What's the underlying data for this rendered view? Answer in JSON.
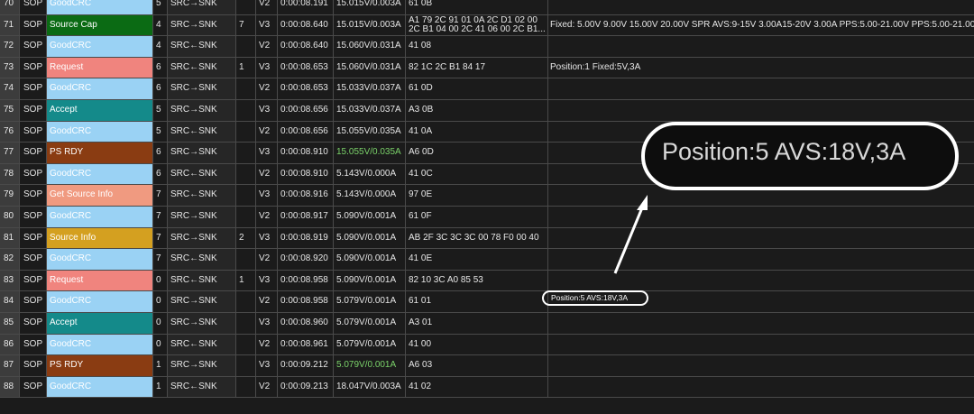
{
  "rows": [
    {
      "idx": "70",
      "sop": "SOP",
      "msg": "GoodCRC",
      "color": "#9ad2f4",
      "text": "#ffffff",
      "cnt": "5",
      "dir": "SRC→SNK",
      "obj": "",
      "ver": "V2",
      "time": "0:00:08.191",
      "vi": "15.015V/0.003A",
      "vi_green": false,
      "raw": "61 0B",
      "dec": ""
    },
    {
      "idx": "71",
      "sop": "SOP",
      "msg": "Source Cap",
      "color": "#0b6b14",
      "text": "#ffffff",
      "cnt": "4",
      "dir": "SRC→SNK",
      "obj": "7",
      "ver": "V3",
      "time": "0:00:08.640",
      "vi": "15.015V/0.003A",
      "vi_green": false,
      "raw": "A1 79 2C 91 01 0A 2C D1 02 00 2C B1 04 00 2C 41 06 00 2C B1...",
      "dec": "Fixed: 5.00V  9.00V  15.00V  20.00V  SPR AVS:9-15V 3.00A15-20V 3.00A  PPS:5.00-21.00V  PPS:5.00-21.00V"
    },
    {
      "idx": "72",
      "sop": "SOP",
      "msg": "GoodCRC",
      "color": "#9ad2f4",
      "text": "#ffffff",
      "cnt": "4",
      "dir": "SRC←SNK",
      "obj": "",
      "ver": "V2",
      "time": "0:00:08.640",
      "vi": "15.060V/0.031A",
      "vi_green": false,
      "raw": "41 08",
      "dec": ""
    },
    {
      "idx": "73",
      "sop": "SOP",
      "msg": "Request",
      "color": "#f0847e",
      "text": "#ffffff",
      "cnt": "6",
      "dir": "SRC←SNK",
      "obj": "1",
      "ver": "V3",
      "time": "0:00:08.653",
      "vi": "15.060V/0.031A",
      "vi_green": false,
      "raw": "82 1C 2C B1 84 17",
      "dec": "Position:1  Fixed:5V,3A"
    },
    {
      "idx": "74",
      "sop": "SOP",
      "msg": "GoodCRC",
      "color": "#9ad2f4",
      "text": "#ffffff",
      "cnt": "6",
      "dir": "SRC→SNK",
      "obj": "",
      "ver": "V2",
      "time": "0:00:08.653",
      "vi": "15.033V/0.037A",
      "vi_green": false,
      "raw": "61 0D",
      "dec": ""
    },
    {
      "idx": "75",
      "sop": "SOP",
      "msg": "Accept",
      "color": "#148a8a",
      "text": "#ffffff",
      "cnt": "5",
      "dir": "SRC→SNK",
      "obj": "",
      "ver": "V3",
      "time": "0:00:08.656",
      "vi": "15.033V/0.037A",
      "vi_green": false,
      "raw": "A3 0B",
      "dec": ""
    },
    {
      "idx": "76",
      "sop": "SOP",
      "msg": "GoodCRC",
      "color": "#9ad2f4",
      "text": "#ffffff",
      "cnt": "5",
      "dir": "SRC←SNK",
      "obj": "",
      "ver": "V2",
      "time": "0:00:08.656",
      "vi": "15.055V/0.035A",
      "vi_green": false,
      "raw": "41 0A",
      "dec": ""
    },
    {
      "idx": "77",
      "sop": "SOP",
      "msg": "PS RDY",
      "color": "#8a3c12",
      "text": "#ffffff",
      "cnt": "6",
      "dir": "SRC→SNK",
      "obj": "",
      "ver": "V3",
      "time": "0:00:08.910",
      "vi": "15.055V/0.035A",
      "vi_green": true,
      "raw": "A6 0D",
      "dec": ""
    },
    {
      "idx": "78",
      "sop": "SOP",
      "msg": "GoodCRC",
      "color": "#9ad2f4",
      "text": "#ffffff",
      "cnt": "6",
      "dir": "SRC←SNK",
      "obj": "",
      "ver": "V2",
      "time": "0:00:08.910",
      "vi": "5.143V/0.000A",
      "vi_green": false,
      "raw": "41 0C",
      "dec": ""
    },
    {
      "idx": "79",
      "sop": "SOP",
      "msg": "Get Source Info",
      "color": "#f09a80",
      "text": "#ffffff",
      "cnt": "7",
      "dir": "SRC←SNK",
      "obj": "",
      "ver": "V3",
      "time": "0:00:08.916",
      "vi": "5.143V/0.000A",
      "vi_green": false,
      "raw": "97 0E",
      "dec": ""
    },
    {
      "idx": "80",
      "sop": "SOP",
      "msg": "GoodCRC",
      "color": "#9ad2f4",
      "text": "#ffffff",
      "cnt": "7",
      "dir": "SRC→SNK",
      "obj": "",
      "ver": "V2",
      "time": "0:00:08.917",
      "vi": "5.090V/0.001A",
      "vi_green": false,
      "raw": "61 0F",
      "dec": ""
    },
    {
      "idx": "81",
      "sop": "SOP",
      "msg": "Source Info",
      "color": "#d4a020",
      "text": "#ffffff",
      "cnt": "7",
      "dir": "SRC→SNK",
      "obj": "2",
      "ver": "V3",
      "time": "0:00:08.919",
      "vi": "5.090V/0.001A",
      "vi_green": false,
      "raw": "AB 2F 3C 3C 3C 00 78 F0 00 40",
      "dec": ""
    },
    {
      "idx": "82",
      "sop": "SOP",
      "msg": "GoodCRC",
      "color": "#9ad2f4",
      "text": "#ffffff",
      "cnt": "7",
      "dir": "SRC←SNK",
      "obj": "",
      "ver": "V2",
      "time": "0:00:08.920",
      "vi": "5.090V/0.001A",
      "vi_green": false,
      "raw": "41 0E",
      "dec": ""
    },
    {
      "idx": "83",
      "sop": "SOP",
      "msg": "Request",
      "color": "#f0847e",
      "text": "#ffffff",
      "cnt": "0",
      "dir": "SRC←SNK",
      "obj": "1",
      "ver": "V3",
      "time": "0:00:08.958",
      "vi": "5.090V/0.001A",
      "vi_green": false,
      "raw": "82 10 3C A0 85 53",
      "dec": ""
    },
    {
      "idx": "84",
      "sop": "SOP",
      "msg": "GoodCRC",
      "color": "#9ad2f4",
      "text": "#ffffff",
      "cnt": "0",
      "dir": "SRC→SNK",
      "obj": "",
      "ver": "V2",
      "time": "0:00:08.958",
      "vi": "5.079V/0.001A",
      "vi_green": false,
      "raw": "61 01",
      "dec": ""
    },
    {
      "idx": "85",
      "sop": "SOP",
      "msg": "Accept",
      "color": "#148a8a",
      "text": "#ffffff",
      "cnt": "0",
      "dir": "SRC→SNK",
      "obj": "",
      "ver": "V3",
      "time": "0:00:08.960",
      "vi": "5.079V/0.001A",
      "vi_green": false,
      "raw": "A3 01",
      "dec": ""
    },
    {
      "idx": "86",
      "sop": "SOP",
      "msg": "GoodCRC",
      "color": "#9ad2f4",
      "text": "#ffffff",
      "cnt": "0",
      "dir": "SRC←SNK",
      "obj": "",
      "ver": "V2",
      "time": "0:00:08.961",
      "vi": "5.079V/0.001A",
      "vi_green": false,
      "raw": "41 00",
      "dec": ""
    },
    {
      "idx": "87",
      "sop": "SOP",
      "msg": "PS RDY",
      "color": "#8a3c12",
      "text": "#ffffff",
      "cnt": "1",
      "dir": "SRC→SNK",
      "obj": "",
      "ver": "V3",
      "time": "0:00:09.212",
      "vi": "5.079V/0.001A",
      "vi_green": true,
      "raw": "A6 03",
      "dec": ""
    },
    {
      "idx": "88",
      "sop": "SOP",
      "msg": "GoodCRC",
      "color": "#9ad2f4",
      "text": "#ffffff",
      "cnt": "1",
      "dir": "SRC←SNK",
      "obj": "",
      "ver": "V2",
      "time": "0:00:09.213",
      "vi": "18.047V/0.003A",
      "vi_green": false,
      "raw": "41 02",
      "dec": ""
    }
  ],
  "highlight": {
    "label": "Position:5 AVS:18V,3A"
  },
  "callout": {
    "label": "Position:5 AVS:18V,3A"
  },
  "colors": {
    "row_border": "#4a4a4a",
    "background": "#1b1b1b",
    "green_value": "#7bd36a"
  }
}
